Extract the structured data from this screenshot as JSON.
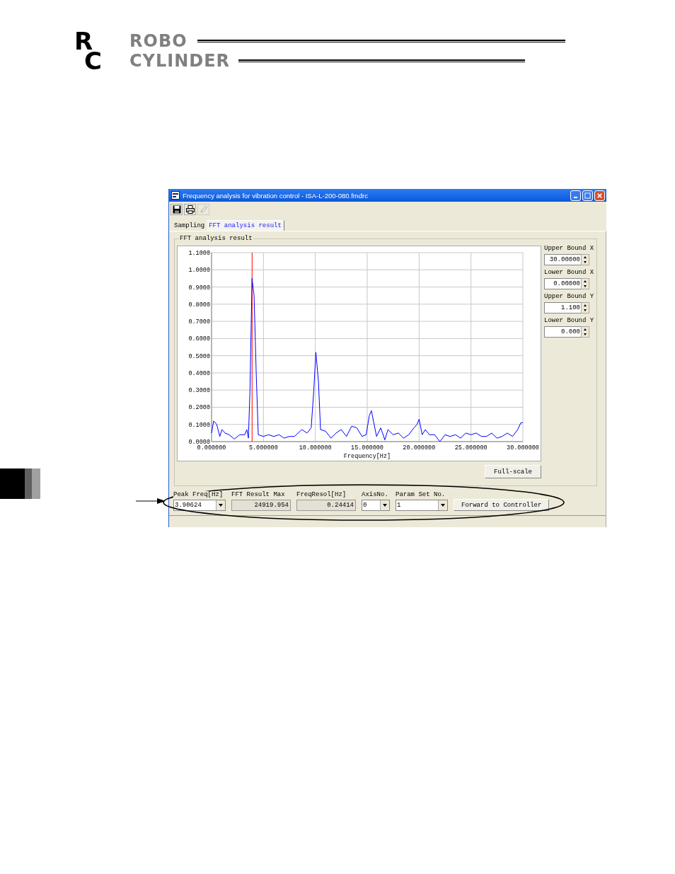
{
  "header": {
    "logo_letters": [
      "R",
      "C"
    ],
    "logo_words": [
      "ROBO",
      "CYLINDER"
    ]
  },
  "window": {
    "title": "Frequency analysis for vibration control - ISA-L-200-080.fmdrc"
  },
  "toolbar": [
    {
      "kind": "save",
      "disabled": false
    },
    {
      "kind": "print",
      "disabled": false
    },
    {
      "kind": "edit",
      "disabled": true
    }
  ],
  "tabs": [
    {
      "label": "Sampling",
      "selected": false
    },
    {
      "label": "FFT analysis result",
      "selected": true
    }
  ],
  "group": {
    "title": "FFT analysis result",
    "chart_data": {
      "type": "line",
      "xlabel": "Frequency[Hz]",
      "xlim": [
        0,
        30
      ],
      "ylim": [
        0,
        1.1
      ],
      "xticks": [
        {
          "value": 0,
          "label": "0.000000"
        },
        {
          "value": 5,
          "label": "5.000000"
        },
        {
          "value": 10,
          "label": "10.000000"
        },
        {
          "value": 15,
          "label": "15.000000"
        },
        {
          "value": 20,
          "label": "20.000000"
        },
        {
          "value": 25,
          "label": "25.000000"
        },
        {
          "value": 30,
          "label": "30.000000"
        }
      ],
      "yticks": [
        {
          "value": 0,
          "label": "0.0000"
        },
        {
          "value": 0.1,
          "label": "0.1000"
        },
        {
          "value": 0.2,
          "label": "0.2000"
        },
        {
          "value": 0.3,
          "label": "0.3000"
        },
        {
          "value": 0.4,
          "label": "0.4000"
        },
        {
          "value": 0.5,
          "label": "0.5000"
        },
        {
          "value": 0.6,
          "label": "0.6000"
        },
        {
          "value": 0.7,
          "label": "0.7000"
        },
        {
          "value": 0.8,
          "label": "0.8000"
        },
        {
          "value": 0.9,
          "label": "0.9000"
        },
        {
          "value": 1.0,
          "label": "1.0000"
        },
        {
          "value": 1.1,
          "label": "1.1000"
        }
      ],
      "x": [
        0,
        0.2,
        0.5,
        0.8,
        1.0,
        1.3,
        1.7,
        2.2,
        2.7,
        3.2,
        3.4,
        3.55,
        3.7,
        3.9,
        4.1,
        4.3,
        4.5,
        5.0,
        5.5,
        6.0,
        6.5,
        7.0,
        7.5,
        8.0,
        8.7,
        9.2,
        9.6,
        9.85,
        10.05,
        10.3,
        10.5,
        11.0,
        11.5,
        12.0,
        12.5,
        13.0,
        13.5,
        14.0,
        14.5,
        14.9,
        15.2,
        15.4,
        15.6,
        15.9,
        16.3,
        16.7,
        17.0,
        17.5,
        18.0,
        18.5,
        19.0,
        19.5,
        19.8,
        20.0,
        20.3,
        20.6,
        21.0,
        21.5,
        22.0,
        22.5,
        23.0,
        23.5,
        24.0,
        24.5,
        25.0,
        25.5,
        26.0,
        26.5,
        27.0,
        27.5,
        28.0,
        28.5,
        29.0,
        29.5,
        29.8,
        30.0
      ],
      "grid": true,
      "series": [
        {
          "color": "#0000ff",
          "values": [
            0.05,
            0.12,
            0.1,
            0.03,
            0.07,
            0.05,
            0.04,
            0.015,
            0.04,
            0.04,
            0.07,
            0.02,
            0.3,
            0.95,
            0.85,
            0.4,
            0.04,
            0.03,
            0.04,
            0.03,
            0.04,
            0.02,
            0.03,
            0.03,
            0.07,
            0.05,
            0.08,
            0.3,
            0.52,
            0.35,
            0.07,
            0.06,
            0.02,
            0.05,
            0.07,
            0.03,
            0.09,
            0.08,
            0.03,
            0.04,
            0.15,
            0.18,
            0.12,
            0.03,
            0.08,
            0.01,
            0.07,
            0.04,
            0.05,
            0.02,
            0.04,
            0.08,
            0.1,
            0.13,
            0.04,
            0.07,
            0.04,
            0.04,
            0.0,
            0.04,
            0.03,
            0.04,
            0.02,
            0.05,
            0.04,
            0.05,
            0.03,
            0.03,
            0.05,
            0.02,
            0.03,
            0.05,
            0.03,
            0.07,
            0.11,
            0.11
          ]
        }
      ],
      "ref_lines": [
        {
          "axis": "x",
          "value": 3.90624,
          "color": "#ff0000"
        }
      ]
    },
    "bounds": [
      {
        "label": "Upper Bound X",
        "value": "30.00000"
      },
      {
        "label": "Lower Bound X",
        "value": "0.00000"
      },
      {
        "label": "Upper Bound Y",
        "value": "1.100"
      },
      {
        "label": "Lower Bound Y",
        "value": "0.000"
      }
    ],
    "full_scale_button": "Full-scale"
  },
  "bottom_fields": [
    {
      "label": "Peak Freq[Hz]",
      "value": "3.90624",
      "kind": "combo"
    },
    {
      "label": "FFT Result Max",
      "value": "24919.954",
      "kind": "readonly"
    },
    {
      "label": "FreqResol[Hz]",
      "value": "0.24414",
      "kind": "readonly"
    },
    {
      "label": "AxisNo.",
      "value": "0",
      "kind": "combo"
    },
    {
      "label": "Param Set No.",
      "value": "1",
      "kind": "combo"
    }
  ],
  "forward_button": "Forward to Controller"
}
